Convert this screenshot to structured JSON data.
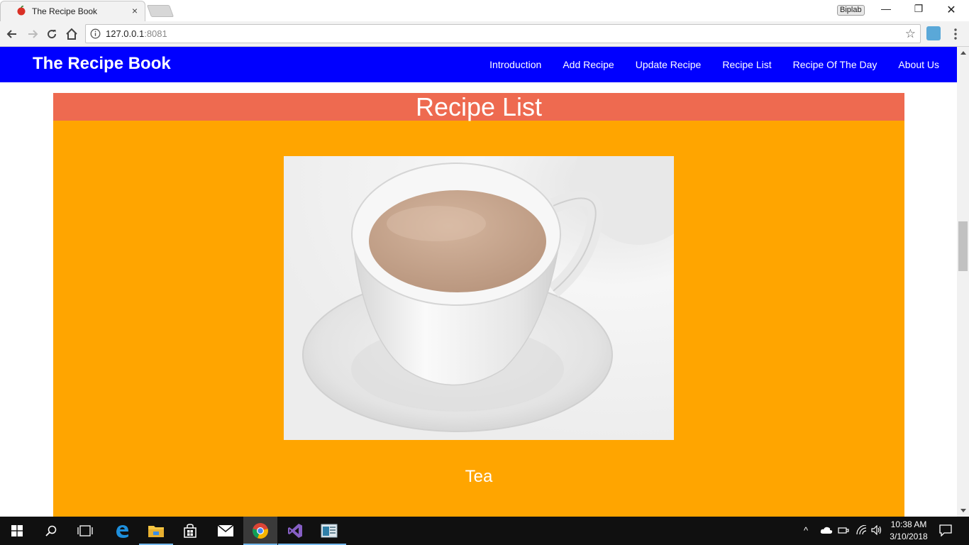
{
  "browser": {
    "tab_title": "The Recipe Book",
    "tab_close": "×",
    "profile_name": "Biplab",
    "url_host": "127.0.0.1",
    "url_port": ":8081",
    "window_min": "—",
    "window_max": "❐",
    "window_close": "✕"
  },
  "site": {
    "brand": "The Recipe Book",
    "nav": [
      "Introduction",
      "Add Recipe",
      "Update Recipe",
      "Recipe List",
      "Recipe Of The Day",
      "About Us"
    ]
  },
  "main": {
    "heading": "Recipe List",
    "recipe": {
      "name": "Tea",
      "image": "cup-of-tea"
    },
    "colors": {
      "navbar": "#0000ff",
      "panel": "#ffa500",
      "header": "#ee6a50"
    }
  },
  "taskbar": {
    "clock_time": "10:38 AM",
    "clock_date": "3/10/2018"
  }
}
